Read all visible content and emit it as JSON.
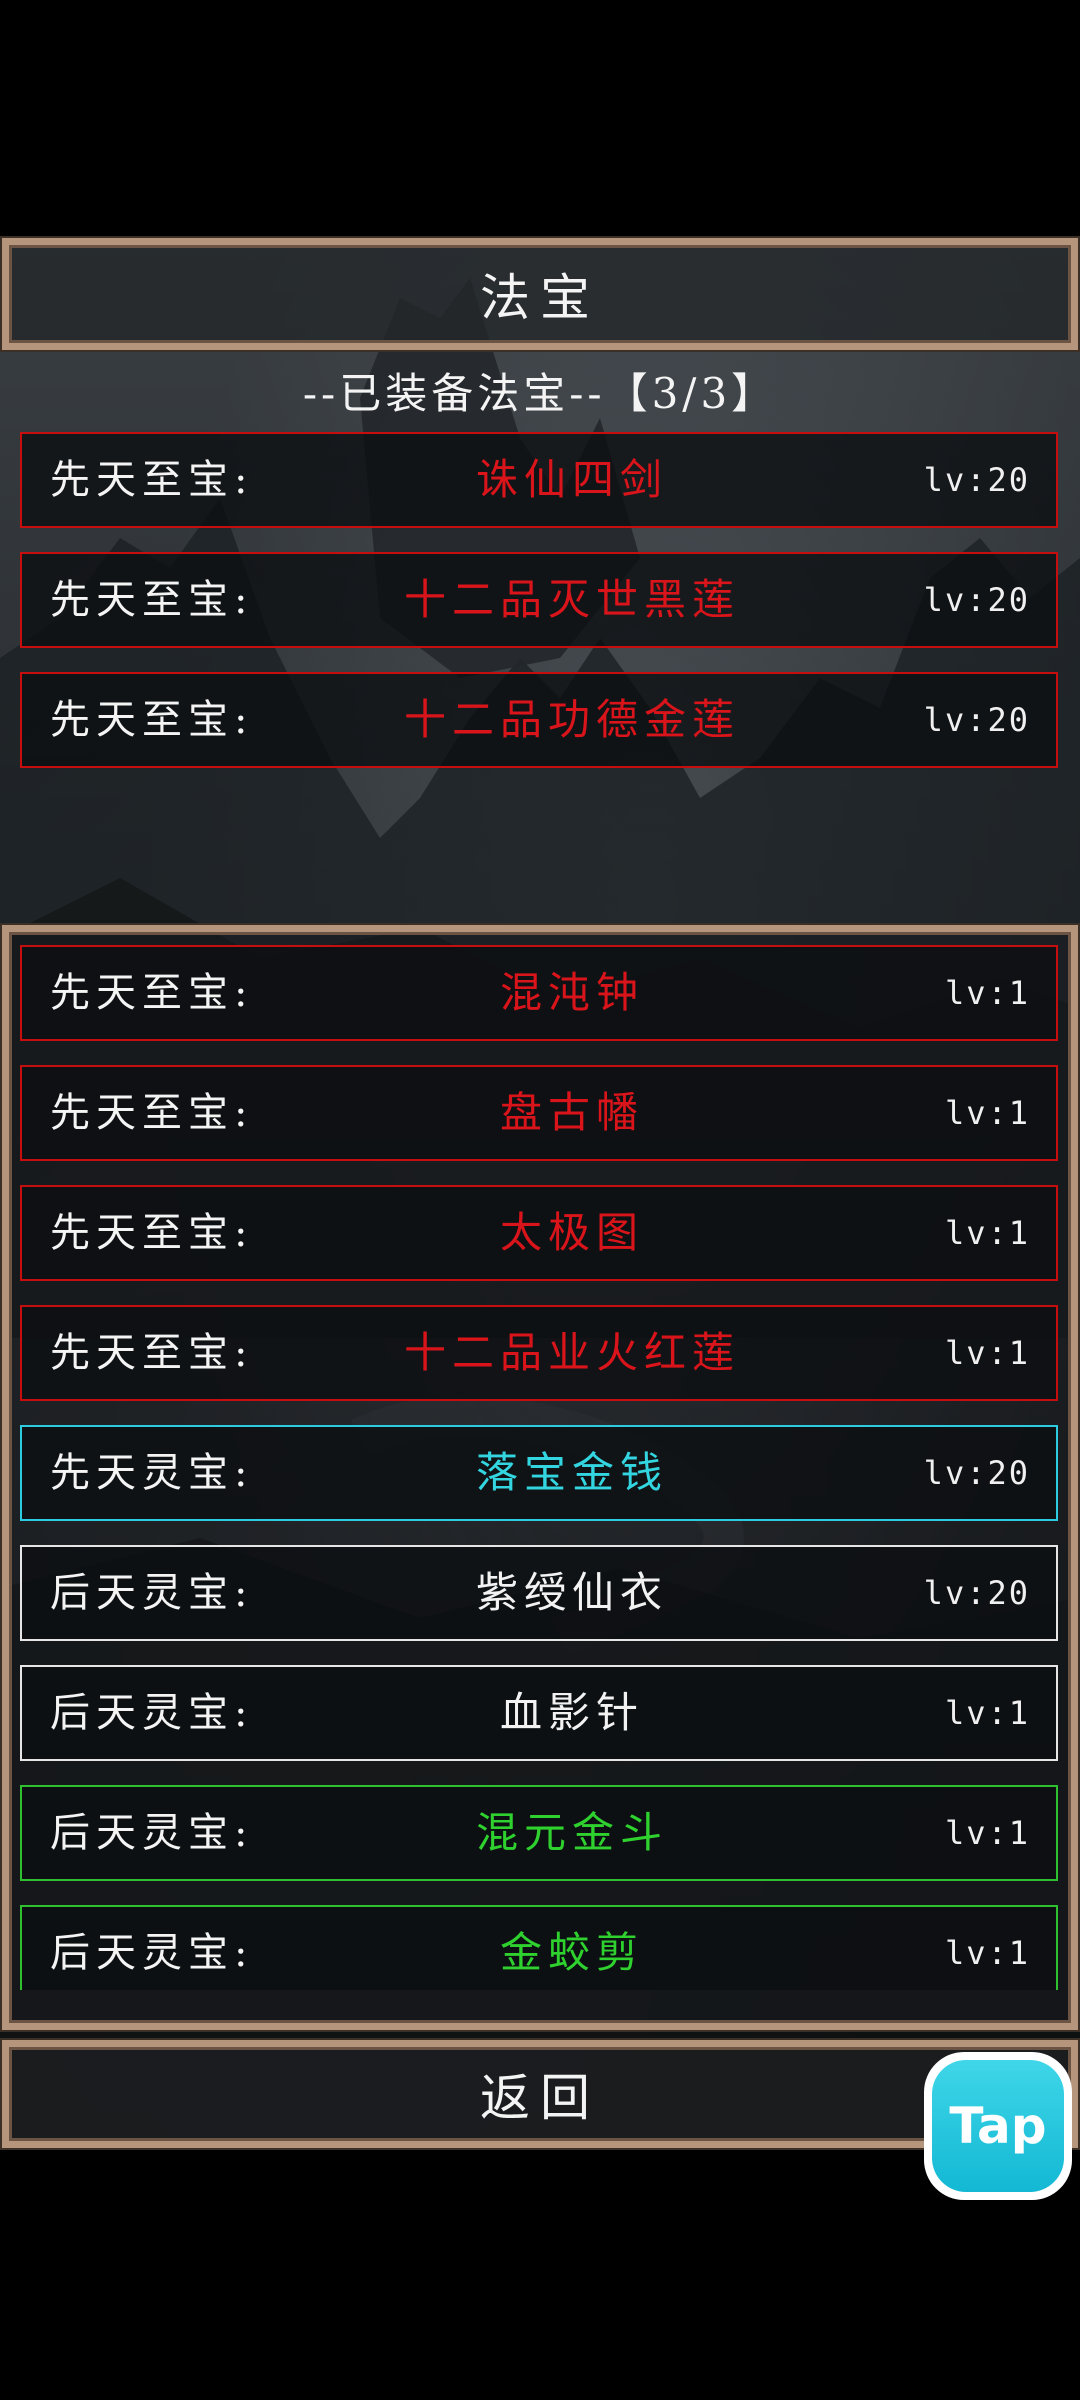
{
  "screen_title": "法宝",
  "equipped_header": "--已装备法宝--【3/3】",
  "equipped": [
    {
      "category": "先天至宝:",
      "name": "诛仙四剑",
      "level": "lv:20",
      "color": "#d9141a"
    },
    {
      "category": "先天至宝:",
      "name": "十二品灭世黑莲",
      "level": "lv:20",
      "color": "#d9141a"
    },
    {
      "category": "先天至宝:",
      "name": "十二品功德金莲",
      "level": "lv:20",
      "color": "#d9141a"
    }
  ],
  "inventory": [
    {
      "category": "先天至宝:",
      "name": "混沌钟",
      "level": "lv:1",
      "color": "#d9141a",
      "border": "#c70e0e"
    },
    {
      "category": "先天至宝:",
      "name": "盘古幡",
      "level": "lv:1",
      "color": "#d9141a",
      "border": "#c70e0e"
    },
    {
      "category": "先天至宝:",
      "name": "太极图",
      "level": "lv:1",
      "color": "#d9141a",
      "border": "#c70e0e"
    },
    {
      "category": "先天至宝:",
      "name": "十二品业火红莲",
      "level": "lv:1",
      "color": "#d9141a",
      "border": "#c70e0e"
    },
    {
      "category": "先天灵宝:",
      "name": "落宝金钱",
      "level": "lv:20",
      "color": "#33d6e0",
      "border": "#2ccbe0"
    },
    {
      "category": "后天灵宝:",
      "name": "紫绶仙衣",
      "level": "lv:20",
      "color": "#f2f2f2",
      "border": "#e6e6e6"
    },
    {
      "category": "后天灵宝:",
      "name": "血影针",
      "level": "lv:1",
      "color": "#f2f2f2",
      "border": "#e6e6e6"
    },
    {
      "category": "后天灵宝:",
      "name": "混元金斗",
      "level": "lv:1",
      "color": "#2ed12e",
      "border": "#2ec02e"
    },
    {
      "category": "后天灵宝:",
      "name": "金蛟剪",
      "level": "lv:1",
      "color": "#2ed12e",
      "border": "#2ec02e"
    }
  ],
  "back_label": "返回",
  "badge_label": "Tap"
}
